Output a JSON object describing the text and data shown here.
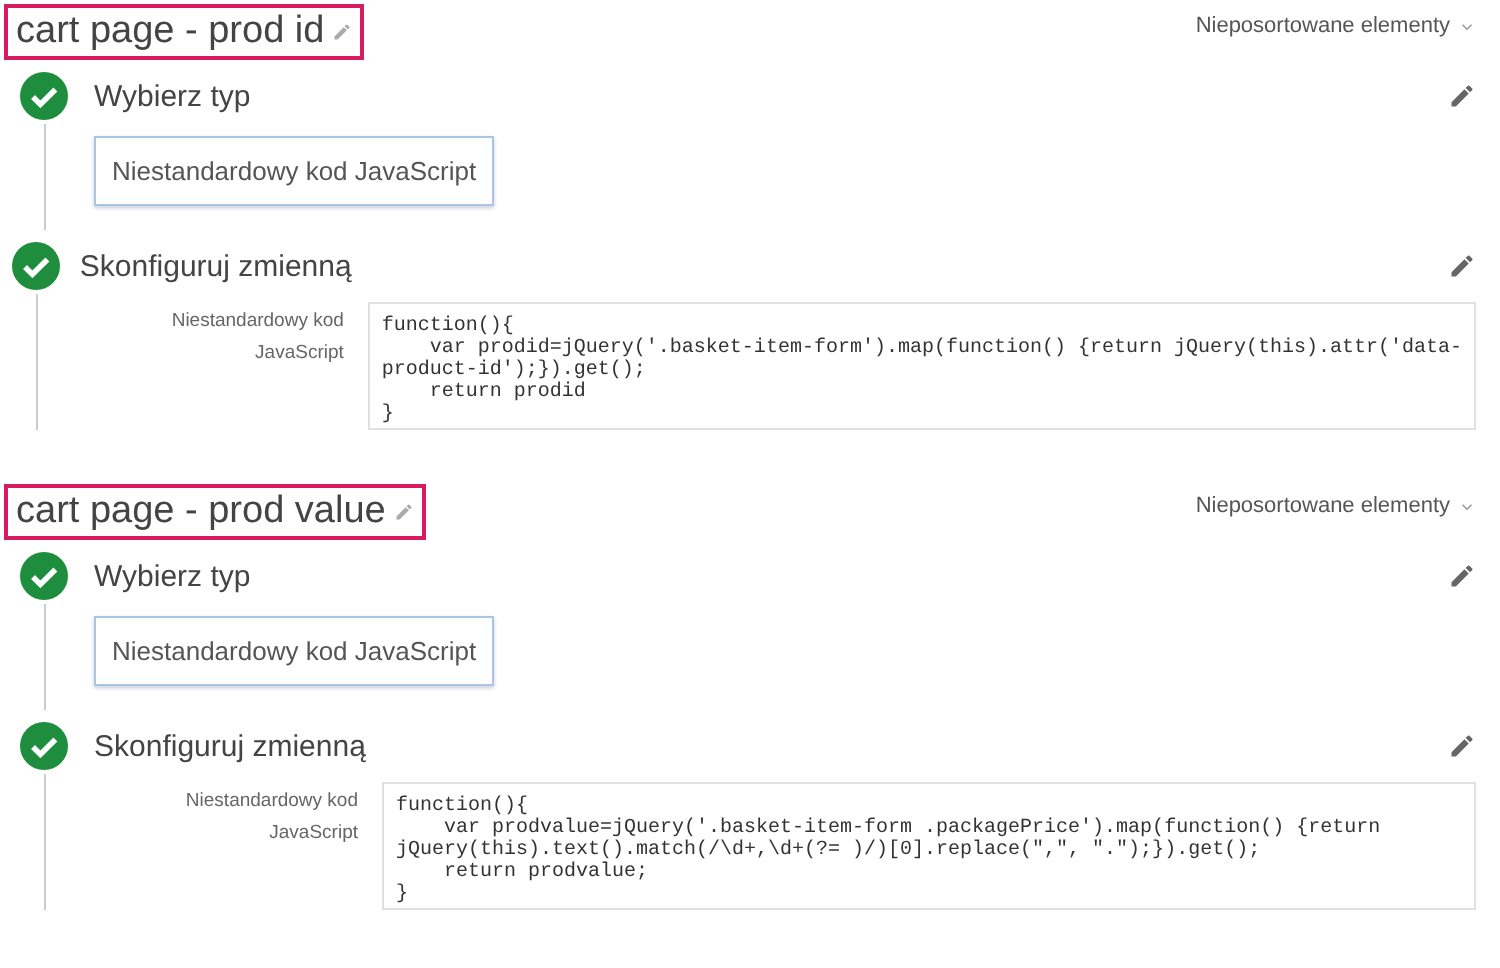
{
  "variables": [
    {
      "title": "cart page - prod id",
      "sort_label": "Nieposortowane elementy",
      "steps": [
        {
          "kind": "type",
          "completed": true,
          "title": "Wybierz typ",
          "value": "Niestandardowy kod JavaScript"
        },
        {
          "kind": "config",
          "completed": true,
          "title": "Skonfiguruj zmienną",
          "field_label": "Niestandardowy kod JavaScript",
          "code_lines": [
            "function(){",
            "    var prodid=jQuery('.basket-item-form').map(function() {return jQuery(this).attr('data-",
            "product-id');}).get();",
            "    return prodid",
            "}"
          ]
        }
      ]
    },
    {
      "title": "cart page - prod value",
      "sort_label": "Nieposortowane elementy",
      "steps": [
        {
          "kind": "type",
          "completed": true,
          "title": "Wybierz typ",
          "value": "Niestandardowy kod JavaScript"
        },
        {
          "kind": "config",
          "completed": true,
          "title": "Skonfiguruj zmienną",
          "field_label": "Niestandardowy kod JavaScript",
          "code_lines": [
            "function(){",
            "    var prodvalue=jQuery('.basket-item-form .packagePrice').map(function() {return",
            "jQuery(this).text().match(/\\d+,\\d+(?= )/)[0].replace(\",\", \".\");}).get();",
            "    return prodvalue;",
            "}"
          ]
        }
      ]
    }
  ]
}
